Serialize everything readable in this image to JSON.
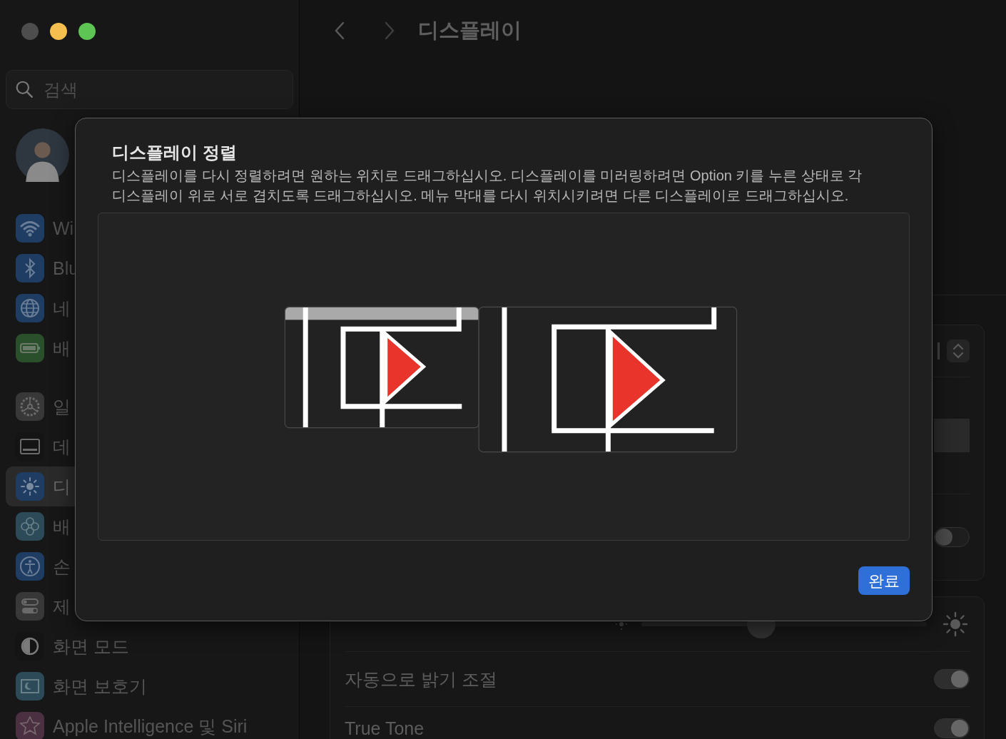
{
  "toolbar": {
    "title": "디스플레이"
  },
  "sidebar": {
    "search": {
      "placeholder": "검색"
    },
    "groups": [
      [
        {
          "label": "Wi",
          "kind": "wifi",
          "color": "#1f3d63",
          "selected": false
        },
        {
          "label": "Blu",
          "kind": "bluetooth",
          "color": "#1f3d63",
          "selected": false
        },
        {
          "label": "네",
          "kind": "globe",
          "color": "#1f3d63",
          "selected": false
        },
        {
          "label": "배",
          "kind": "battery",
          "color": "#2a4f2b",
          "selected": false
        }
      ],
      [
        {
          "label": "일",
          "kind": "gear",
          "color": "#383838",
          "selected": false
        },
        {
          "label": "데",
          "kind": "dock",
          "color": "#141414",
          "selected": false
        },
        {
          "label": "디",
          "kind": "sun",
          "color": "#1f3d63",
          "selected": true
        },
        {
          "label": "배",
          "kind": "flower",
          "color": "#2c4a57",
          "selected": false
        },
        {
          "label": "손",
          "kind": "person",
          "color": "#1f3d63",
          "selected": false
        },
        {
          "label": "제",
          "kind": "switches",
          "color": "#383838",
          "selected": false
        },
        {
          "label": "화면 모드",
          "kind": "halfcircle",
          "color": "#141414",
          "selected": false
        },
        {
          "label": "화면 보호기",
          "kind": "moon",
          "color": "#2c4a57",
          "selected": false
        },
        {
          "label": "Apple Intelligence 및 Siri",
          "kind": "star",
          "color": "#4a3040",
          "selected": false
        }
      ]
    ]
  },
  "cards": [
    {
      "rows": [
        {
          "kind": "stepper"
        },
        {
          "kind": "preview"
        },
        {
          "kind": "toggle",
          "on": false
        }
      ]
    },
    {
      "rows": [
        {
          "kind": "slider",
          "level": 0.42
        },
        {
          "kind": "toggle",
          "label": "자동으로 밝기 조절",
          "on": true
        },
        {
          "kind": "toggle",
          "label": "True Tone",
          "on": true
        }
      ]
    }
  ],
  "dialog": {
    "title": "디스플레이 정렬",
    "description": "디스플레이를 다시 정렬하려면 원하는 위치로 드래그하십시오. 디스플레이를 미러링하려면 Option 키를 누른 상태로 각 디스플레이 위로 서로 겹치도록 드래그하십시오. 메뉴 막대를 다시 위치시키려면 다른 디스플레이로 드래그하십시오.",
    "displays": [
      {
        "menu_bar": true
      },
      {
        "menu_bar": false
      }
    ],
    "done_button": "완료"
  }
}
